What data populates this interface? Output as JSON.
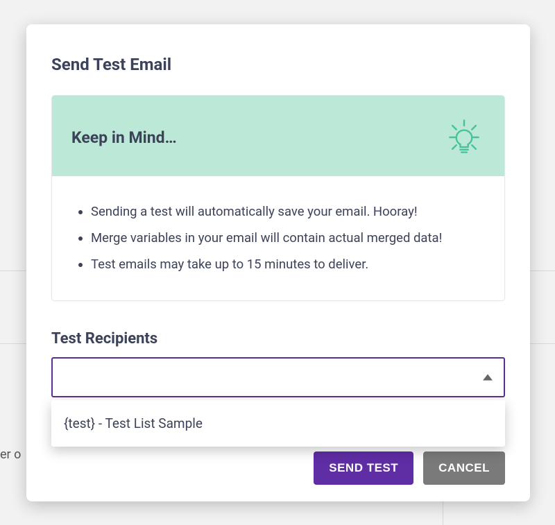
{
  "modal": {
    "title": "Send Test Email",
    "tip": {
      "title": "Keep in Mind…",
      "items": [
        "Sending a test will automatically save your email. Hooray!",
        "Merge variables in your email will contain actual merged data!",
        "Test emails may take up to 15 minutes to deliver."
      ]
    },
    "recipients": {
      "label": "Test Recipients",
      "value": "",
      "options": [
        "{test} - Test List Sample"
      ]
    },
    "actions": {
      "primary": "SEND TEST",
      "secondary": "CANCEL"
    }
  },
  "background": {
    "text_fragment": "er o"
  }
}
